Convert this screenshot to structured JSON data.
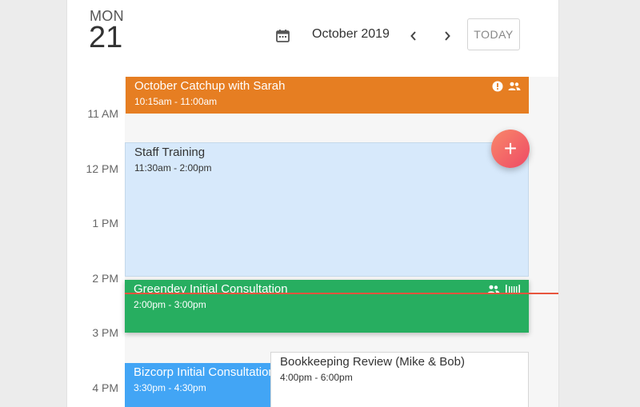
{
  "header": {
    "day_name": "MON",
    "day_number": "21",
    "month_label": "October 2019",
    "today_label": "TODAY"
  },
  "time_labels": [
    "11 AM",
    "12 PM",
    "1 PM",
    "2 PM",
    "3 PM",
    "4 PM"
  ],
  "events": [
    {
      "title": "October Catchup with Sarah",
      "time": "10:15am - 11:00am",
      "color": "#e67e22"
    },
    {
      "title": "Staff Training",
      "time": "11:30am - 2:00pm",
      "color": "#d7e9fb"
    },
    {
      "title": "Greendev Initial Consultation",
      "time": "2:00pm - 3:00pm",
      "color": "#27ae60"
    },
    {
      "title": "Bizcorp Initial Consultation",
      "time": "3:30pm - 4:30pm",
      "color": "#42a5f5"
    },
    {
      "title": "Bookkeeping Review (Mike & Bob)",
      "time": "4:00pm - 6:00pm",
      "color": "#ffffff"
    }
  ],
  "icons": {
    "calendar": "calendar-icon",
    "prev": "chevron-left-icon",
    "next": "chevron-right-icon",
    "alert": "alert-icon",
    "people": "people-icon",
    "grip": "drag-handle-icon",
    "add": "add-icon"
  },
  "fab_label": "+",
  "colors": {
    "now_line": "#e8553e",
    "fab_start": "#f9886a",
    "fab_end": "#ee4a65"
  }
}
